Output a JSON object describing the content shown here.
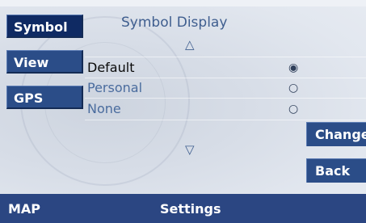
{
  "sidebar": {
    "items": [
      {
        "label": "Symbol",
        "active": true
      },
      {
        "label": "View",
        "active": false
      },
      {
        "label": "GPS",
        "active": false
      }
    ]
  },
  "main": {
    "title": "Symbol Display",
    "scroll_up_glyph": "△",
    "scroll_down_glyph": "▽",
    "options": [
      {
        "label": "Default",
        "selected": true,
        "radio": "◉"
      },
      {
        "label": "Personal",
        "selected": false,
        "radio": "○"
      },
      {
        "label": "None",
        "selected": false,
        "radio": "○"
      }
    ]
  },
  "buttons": {
    "change": "Change",
    "back": "Back"
  },
  "statusbar": {
    "left": "MAP",
    "center": "Settings"
  },
  "colors": {
    "button_bg": "#2b4d88",
    "button_active_bg": "#0f2a63",
    "statusbar_bg": "#2b4682",
    "text_blue": "#4a6c9e"
  }
}
